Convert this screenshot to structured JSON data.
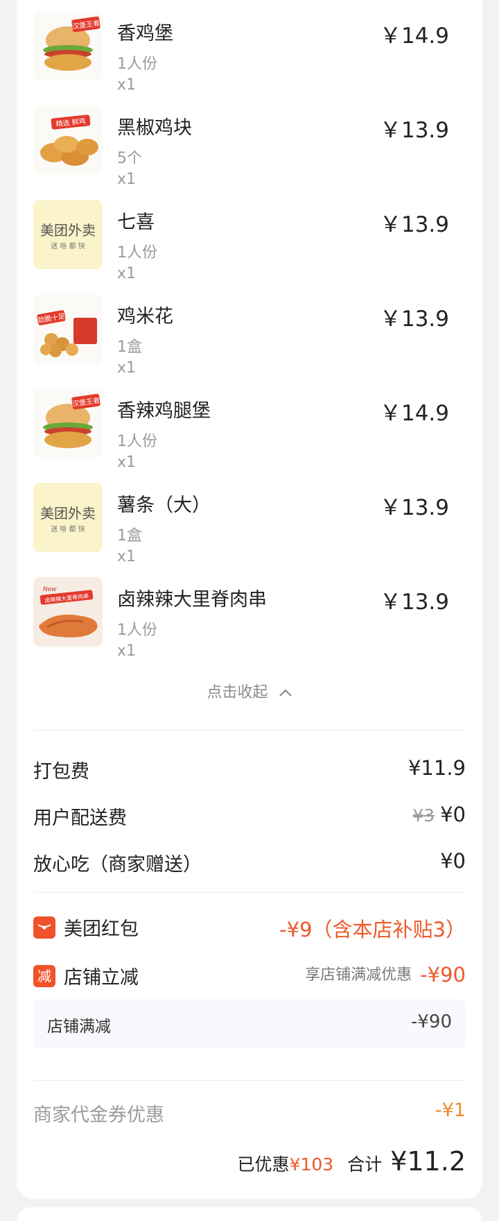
{
  "items": [
    {
      "name": "香鸡堡",
      "spec": "1人份",
      "qty": "x1",
      "price": "￥14.9",
      "thumb": "burger-1"
    },
    {
      "name": "黑椒鸡块",
      "spec": "5个",
      "qty": "x1",
      "price": "￥13.9",
      "thumb": "nuggets"
    },
    {
      "name": "七喜",
      "spec": "1人份",
      "qty": "x1",
      "price": "￥13.9",
      "thumb": "meituan-placeholder"
    },
    {
      "name": "鸡米花",
      "spec": "1盒",
      "qty": "x1",
      "price": "￥13.9",
      "thumb": "popcorn-chicken"
    },
    {
      "name": "香辣鸡腿堡",
      "spec": "1人份",
      "qty": "x1",
      "price": "￥14.9",
      "thumb": "burger-2"
    },
    {
      "name": "薯条（大）",
      "spec": "1盒",
      "qty": "x1",
      "price": "￥13.9",
      "thumb": "meituan-placeholder"
    },
    {
      "name": "卤辣辣大里脊肉串",
      "spec": "1人份",
      "qty": "x1",
      "price": "￥13.9",
      "thumb": "skewer"
    }
  ],
  "thumb_text": {
    "burger_badge": "汉堡王者",
    "nuggets_badge": "精选 鲜鸡",
    "popcorn_badge": "劲脆十足",
    "skewer_badge_new": "New",
    "skewer_badge": "卤辣辣大里脊肉串",
    "meituan_title": "美团外卖",
    "meituan_sub": "送 啥 都 快"
  },
  "collapse_label": "点击收起",
  "fees": {
    "packing_label": "打包费",
    "packing_value": "¥11.9",
    "delivery_label": "用户配送费",
    "delivery_original": "¥3",
    "delivery_value": "¥0",
    "safe_label": "放心吃（商家赠送）",
    "safe_value": "¥0"
  },
  "discounts": {
    "redpacket_label": "美团红包",
    "redpacket_value": "-¥9（含本店补贴3）",
    "shop_icon": "减",
    "shop_label": "店铺立减",
    "shop_hint": "享店铺满减优惠",
    "shop_value": "-¥90",
    "sub_label": "店铺满减",
    "sub_value": "-¥90"
  },
  "voucher": {
    "label": "商家代金券优惠",
    "value": "-¥1"
  },
  "summary": {
    "saved_label": "已优惠",
    "saved_value": "¥103",
    "total_label": "合计",
    "total_value": "¥11.2"
  },
  "colors": {
    "accent": "#ec5a2a",
    "badge": "#f0522b",
    "voucher": "#f08a2a"
  }
}
